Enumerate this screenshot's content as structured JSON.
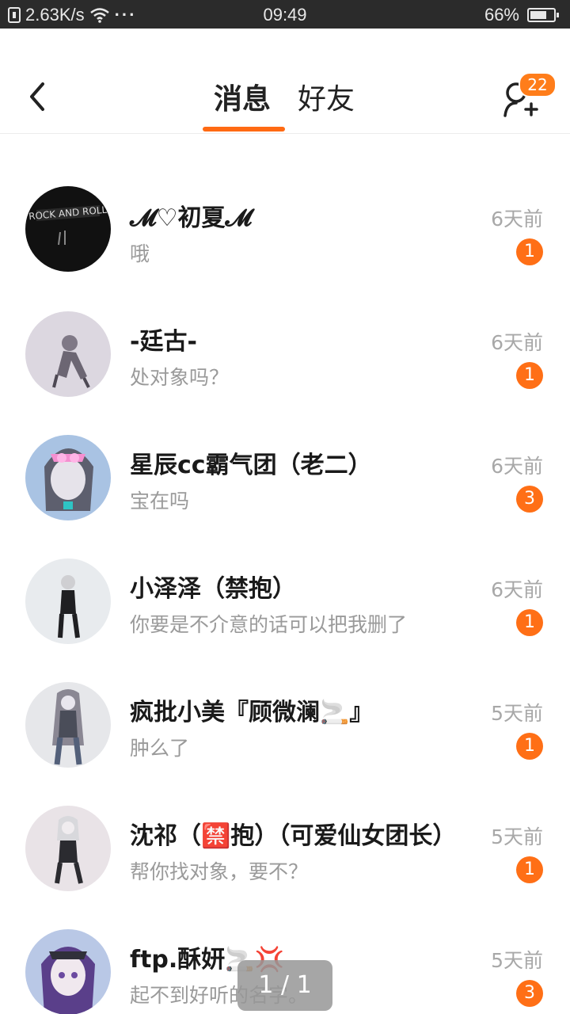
{
  "status_bar": {
    "speed": "2.63K/s",
    "dots": "···",
    "time": "09:49",
    "battery": "66%",
    "icons": [
      "sim-icon",
      "wifi-icon",
      "battery-icon"
    ]
  },
  "header": {
    "tabs": [
      {
        "label": "消息",
        "active": true
      },
      {
        "label": "好友",
        "active": false
      }
    ],
    "add_friend_badge": "22",
    "accent_color": "#ff6a13"
  },
  "messages": [
    {
      "name": "𝓜♡初夏𝓜",
      "preview": "哦",
      "time": "6天前",
      "count": "1"
    },
    {
      "name": "-廷古-",
      "preview": "处对象吗？",
      "time": "6天前",
      "count": "1"
    },
    {
      "name": "星辰cc霸气团（老二）",
      "preview": "宝在吗",
      "time": "6天前",
      "count": "3"
    },
    {
      "name": "小泽泽（禁抱）",
      "preview": "你要是不介意的话可以把我删了",
      "time": "6天前",
      "count": "1"
    },
    {
      "name": "疯批小美『顾微澜🚬』",
      "preview": "肿么了",
      "time": "5天前",
      "count": "1"
    },
    {
      "name": "沈祁（🈲抱）（可爱仙女团长）",
      "preview": "帮你找对象，要不？",
      "time": "5天前",
      "count": "1"
    },
    {
      "name": "ftp.酥妍🚬💢",
      "preview": "起不到好听的名字。",
      "time": "5天前",
      "count": "3"
    }
  ],
  "page_indicator": "1 / 1"
}
